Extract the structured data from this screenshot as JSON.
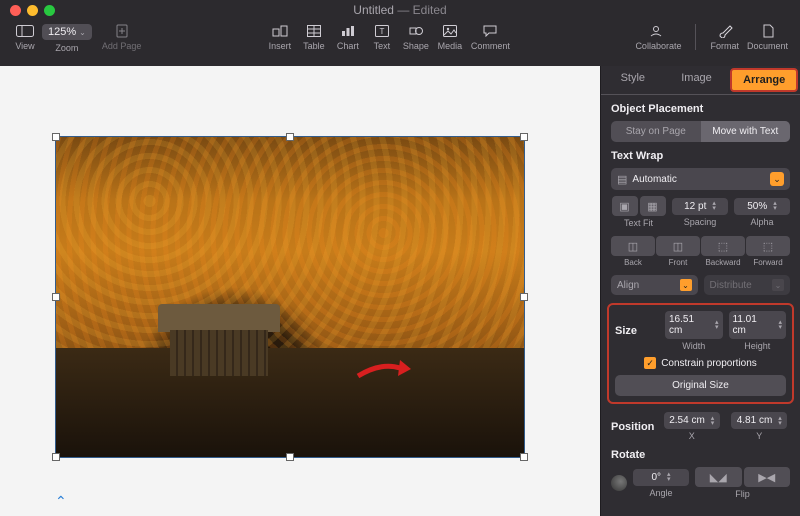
{
  "title": {
    "name": "Untitled",
    "status": "Edited"
  },
  "toolbar": {
    "view": "View",
    "zoom": {
      "value": "125%",
      "label": "Zoom"
    },
    "add_page": "Add Page",
    "insert": "Insert",
    "table": "Table",
    "chart": "Chart",
    "text": "Text",
    "shape": "Shape",
    "media": "Media",
    "comment": "Comment",
    "collaborate": "Collaborate",
    "format": "Format",
    "document": "Document"
  },
  "panel": {
    "tabs": {
      "style": "Style",
      "image": "Image",
      "arrange": "Arrange"
    },
    "placement": {
      "label": "Object Placement",
      "stay": "Stay on Page",
      "move": "Move with Text"
    },
    "wrap": {
      "label": "Text Wrap",
      "mode": "Automatic",
      "textfit": "Text Fit",
      "spacing": {
        "value": "12 pt",
        "label": "Spacing"
      },
      "alpha": {
        "value": "50%",
        "label": "Alpha"
      }
    },
    "order": {
      "back": "Back",
      "front": "Front",
      "backward": "Backward",
      "forward": "Forward"
    },
    "align": {
      "align": "Align",
      "distribute": "Distribute"
    },
    "size": {
      "label": "Size",
      "width": {
        "value": "16.51 cm",
        "label": "Width"
      },
      "height": {
        "value": "11.01 cm",
        "label": "Height"
      },
      "constrain": "Constrain proportions",
      "original": "Original Size"
    },
    "position": {
      "label": "Position",
      "x": {
        "value": "2.54 cm",
        "label": "X"
      },
      "y": {
        "value": "4.81 cm",
        "label": "Y"
      }
    },
    "rotate": {
      "label": "Rotate",
      "angle": {
        "value": "0°",
        "label": "Angle"
      },
      "flip": "Flip"
    }
  }
}
